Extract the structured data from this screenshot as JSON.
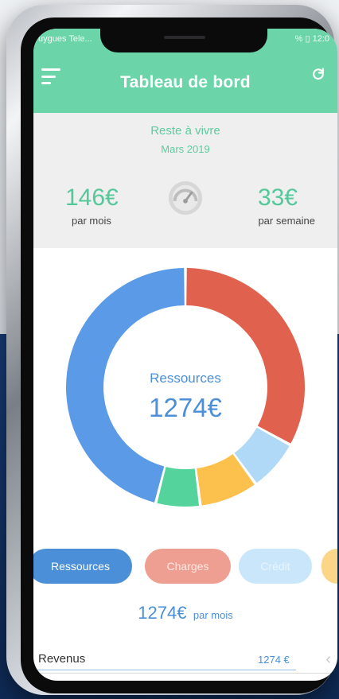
{
  "status_bar": {
    "carrier": "uygues Tele...",
    "right": "% ▯ 12:0"
  },
  "app": {
    "title": "Tableau de bord"
  },
  "summary": {
    "label": "Reste à vivre",
    "month": "Mars 2019",
    "monthly_value": "146€",
    "monthly_label": "par mois",
    "weekly_value": "33€",
    "weekly_label": "par semaine"
  },
  "chart_data": {
    "type": "pie",
    "center_label": "Ressources",
    "center_value": "1274€",
    "slices": [
      {
        "value": 33,
        "color": "#e0614d"
      },
      {
        "value": 7,
        "color": "#b0d9f7"
      },
      {
        "value": 8,
        "color": "#fcc04d"
      },
      {
        "value": 6,
        "color": "#55d39c"
      },
      {
        "value": 46,
        "color": "#5a9ae6"
      }
    ]
  },
  "tabs": {
    "ressources": "Ressources",
    "charges": "Charges",
    "credit": "Crédit"
  },
  "total": {
    "value": "1274€",
    "unit": "par mois"
  },
  "rows": [
    {
      "label": "Revenus",
      "value": "1274 €"
    }
  ],
  "colors": {
    "green": "#6bd4a9",
    "blue": "#4b8fd9",
    "red": "#e0614d",
    "light_blue": "#b0d9f7",
    "yellow": "#fcc04d"
  }
}
